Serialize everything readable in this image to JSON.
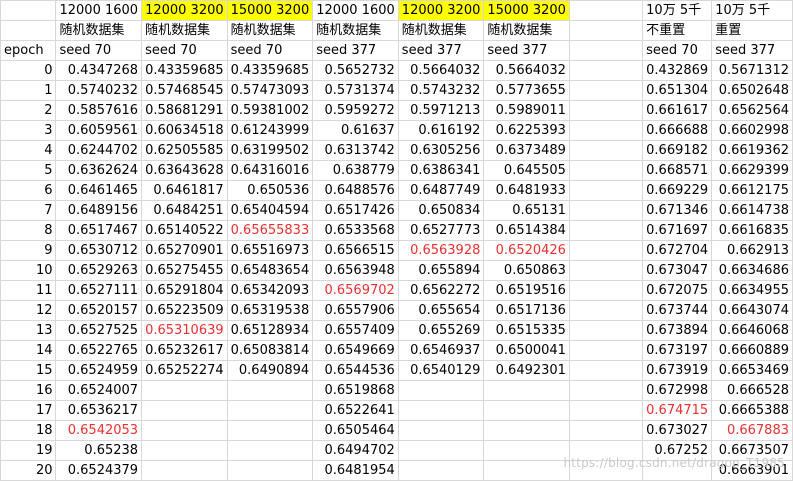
{
  "header": {
    "row1": [
      "",
      "12000 1600",
      "12000 3200",
      "15000 3200",
      "12000 1600",
      "12000 3200",
      "15000 3200",
      "",
      "10万 5千",
      "10万 5千"
    ],
    "row2": [
      "",
      "随机数据集",
      "随机数据集",
      "随机数据集",
      "随机数据集",
      "随机数据集",
      "随机数据集",
      "",
      "不重置",
      "重置"
    ],
    "row3": [
      "epoch",
      "seed 70",
      "seed 70",
      "seed 70",
      "seed 377",
      "seed 377",
      "seed 377",
      "",
      "seed 70",
      "seed 377"
    ]
  },
  "highlighted_header_cells": [
    2,
    3,
    5,
    6
  ],
  "rows": [
    {
      "epoch": "0",
      "vals": [
        "0.4347268",
        "0.43359685",
        "0.43359685",
        "0.5652732",
        "0.5664032",
        "0.5664032",
        "",
        "0.432869",
        "0.5671312"
      ]
    },
    {
      "epoch": "1",
      "vals": [
        "0.5740232",
        "0.57468545",
        "0.57473093",
        "0.5731374",
        "0.5743232",
        "0.5773655",
        "",
        "0.651304",
        "0.6502648"
      ]
    },
    {
      "epoch": "2",
      "vals": [
        "0.5857616",
        "0.58681291",
        "0.59381002",
        "0.5959272",
        "0.5971213",
        "0.5989011",
        "",
        "0.661617",
        "0.6562564"
      ]
    },
    {
      "epoch": "3",
      "vals": [
        "0.6059561",
        "0.60634518",
        "0.61243999",
        "0.61637",
        "0.616192",
        "0.6225393",
        "",
        "0.666688",
        "0.6602998"
      ]
    },
    {
      "epoch": "4",
      "vals": [
        "0.6244702",
        "0.62505585",
        "0.63199502",
        "0.6313742",
        "0.6305256",
        "0.6373489",
        "",
        "0.669182",
        "0.6619362"
      ]
    },
    {
      "epoch": "5",
      "vals": [
        "0.6362624",
        "0.63643628",
        "0.64316016",
        "0.638779",
        "0.6386341",
        "0.645505",
        "",
        "0.668571",
        "0.6629399"
      ]
    },
    {
      "epoch": "6",
      "vals": [
        "0.6461465",
        "0.6461817",
        "0.650536",
        "0.6488576",
        "0.6487749",
        "0.6481933",
        "",
        "0.669229",
        "0.6612175"
      ]
    },
    {
      "epoch": "7",
      "vals": [
        "0.6489156",
        "0.6484251",
        "0.65404594",
        "0.6517426",
        "0.650834",
        "0.65131",
        "",
        "0.671346",
        "0.6614738"
      ]
    },
    {
      "epoch": "8",
      "vals": [
        "0.6517467",
        "0.65140522",
        "0.65655833",
        "0.6533568",
        "0.6527773",
        "0.6514384",
        "",
        "0.671697",
        "0.6616835"
      ]
    },
    {
      "epoch": "9",
      "vals": [
        "0.6530712",
        "0.65270901",
        "0.65516973",
        "0.6566515",
        "0.6563928",
        "0.6520426",
        "",
        "0.672704",
        "0.662913"
      ]
    },
    {
      "epoch": "10",
      "vals": [
        "0.6529263",
        "0.65275455",
        "0.65483654",
        "0.6563948",
        "0.655894",
        "0.650863",
        "",
        "0.673047",
        "0.6634686"
      ]
    },
    {
      "epoch": "11",
      "vals": [
        "0.6527111",
        "0.65291804",
        "0.65342093",
        "0.6569702",
        "0.6562272",
        "0.6519516",
        "",
        "0.672075",
        "0.6634955"
      ]
    },
    {
      "epoch": "12",
      "vals": [
        "0.6520157",
        "0.65223509",
        "0.65319538",
        "0.6557906",
        "0.655654",
        "0.6517136",
        "",
        "0.673744",
        "0.6643074"
      ]
    },
    {
      "epoch": "13",
      "vals": [
        "0.6527525",
        "0.65310639",
        "0.65128934",
        "0.6557409",
        "0.655269",
        "0.6515335",
        "",
        "0.673894",
        "0.6646068"
      ]
    },
    {
      "epoch": "14",
      "vals": [
        "0.6522765",
        "0.65232617",
        "0.65083814",
        "0.6549669",
        "0.6546937",
        "0.6500041",
        "",
        "0.673197",
        "0.6660889"
      ]
    },
    {
      "epoch": "15",
      "vals": [
        "0.6524959",
        "0.65252274",
        "0.6490894",
        "0.6544536",
        "0.6540129",
        "0.6492301",
        "",
        "0.673919",
        "0.6653469"
      ]
    },
    {
      "epoch": "16",
      "vals": [
        "0.6524007",
        "",
        "",
        "0.6519868",
        "",
        "",
        "",
        "0.672998",
        "0.666528"
      ]
    },
    {
      "epoch": "17",
      "vals": [
        "0.6536217",
        "",
        "",
        "0.6522641",
        "",
        "",
        "",
        "0.674715",
        "0.6665388"
      ]
    },
    {
      "epoch": "18",
      "vals": [
        "0.6542053",
        "",
        "",
        "0.6505464",
        "",
        "",
        "",
        "0.673027",
        "0.667883"
      ]
    },
    {
      "epoch": "19",
      "vals": [
        "0.65238",
        "",
        "",
        "0.6494702",
        "",
        "",
        "",
        "0.67252",
        "0.6673507"
      ]
    },
    {
      "epoch": "20",
      "vals": [
        "0.6524379",
        "",
        "",
        "0.6481954",
        "",
        "",
        "",
        "",
        "0.6663901"
      ]
    }
  ],
  "red_cells": [
    [
      8,
      3
    ],
    [
      9,
      5
    ],
    [
      9,
      6
    ],
    [
      11,
      4
    ],
    [
      13,
      2
    ],
    [
      17,
      8
    ],
    [
      18,
      1
    ],
    [
      18,
      9
    ]
  ],
  "colors": {
    "highlight": "#ffff00",
    "red_value": "#e83030",
    "grid": "#d8d8d8"
  },
  "watermark": "https://blog.csdn.net/dragon_T1985"
}
